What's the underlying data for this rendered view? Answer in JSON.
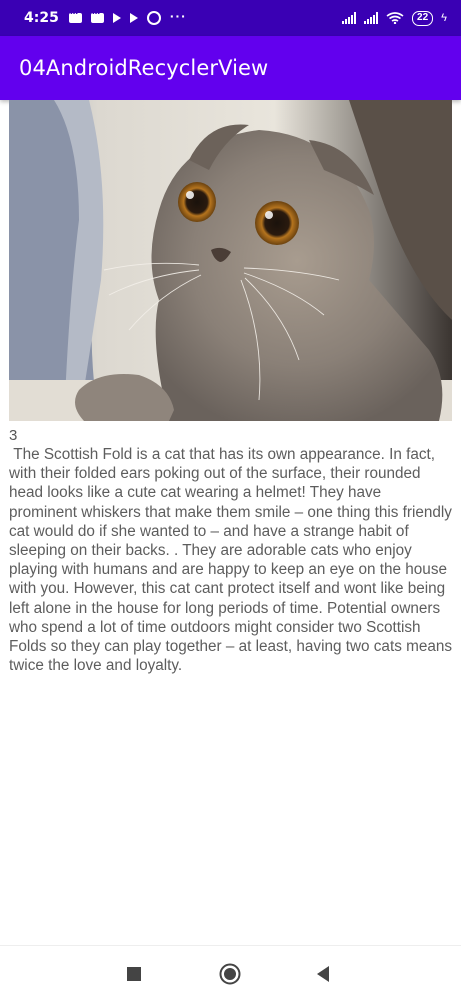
{
  "status_bar": {
    "time": "4:25",
    "battery": "22",
    "icons": [
      "message-icon",
      "message-icon",
      "play-icon",
      "play-icon",
      "whatsapp-icon",
      "more-dots-icon",
      "signal-icon",
      "signal-icon",
      "wifi-icon",
      "battery-icon",
      "charging-icon"
    ],
    "more": "···",
    "bolt": "ϟ"
  },
  "app_bar": {
    "title": "04AndroidRecyclerView",
    "color": "#6200ee",
    "status_color": "#3a00b4"
  },
  "list": {
    "items": [
      {
        "image": "scottish-fold-cat-photo",
        "number": "3",
        "description": " The Scottish Fold is a cat that has its own appearance. In fact, with their folded ears poking out of the surface, their rounded head looks like a cute cat wearing a helmet! They have prominent whiskers that make them smile – one thing this friendly cat would do if she wanted to – and have a strange habit of sleeping on their backs. . They are adorable cats who enjoy playing with humans and are happy to keep an eye on the house with you. However, this cat cant protect itself and wont like being left alone in the house for long periods of time. Potential owners who spend a lot of time outdoors might consider two Scottish Folds so they can play together – at least, having two cats means twice the love and loyalty."
      }
    ]
  },
  "nav_bar": {
    "buttons": [
      "recents-icon",
      "home-icon",
      "back-icon"
    ]
  }
}
